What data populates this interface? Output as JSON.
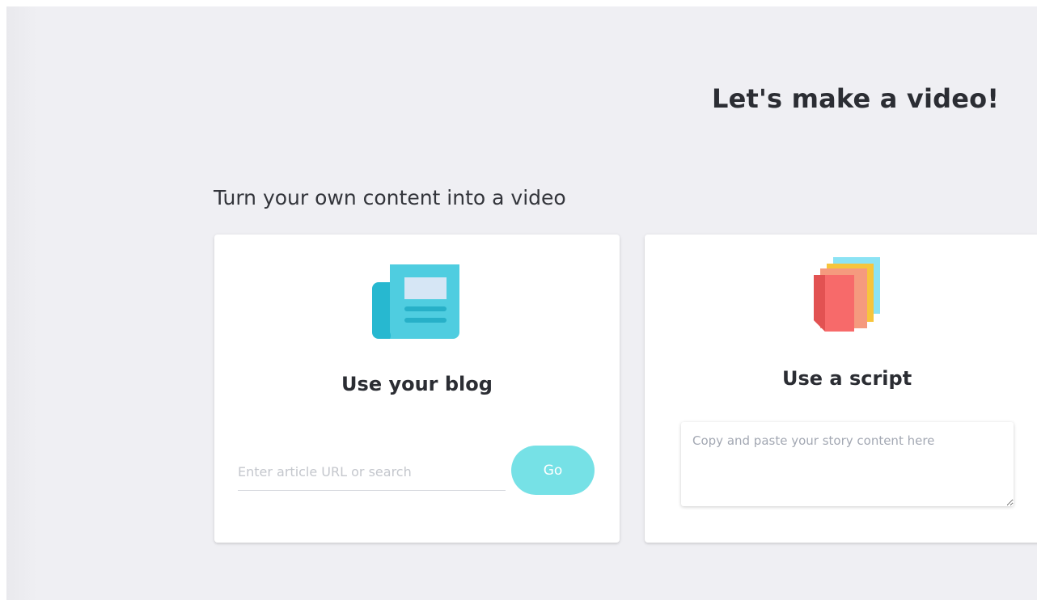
{
  "header": {
    "title": "Let's make a video!"
  },
  "section": {
    "title": "Turn your own content into a video"
  },
  "cards": {
    "blog": {
      "icon": "newspaper-icon",
      "title": "Use your blog",
      "input_placeholder": "Enter article URL or search",
      "input_value": "",
      "button_label": "Go"
    },
    "script": {
      "icon": "stacked-pages-icon",
      "title": "Use a script",
      "textarea_placeholder": "Copy and paste your story content here",
      "textarea_value": ""
    }
  },
  "colors": {
    "background": "#efeff3",
    "card": "#ffffff",
    "accent": "#76e1e6",
    "text": "#2b2d33"
  }
}
